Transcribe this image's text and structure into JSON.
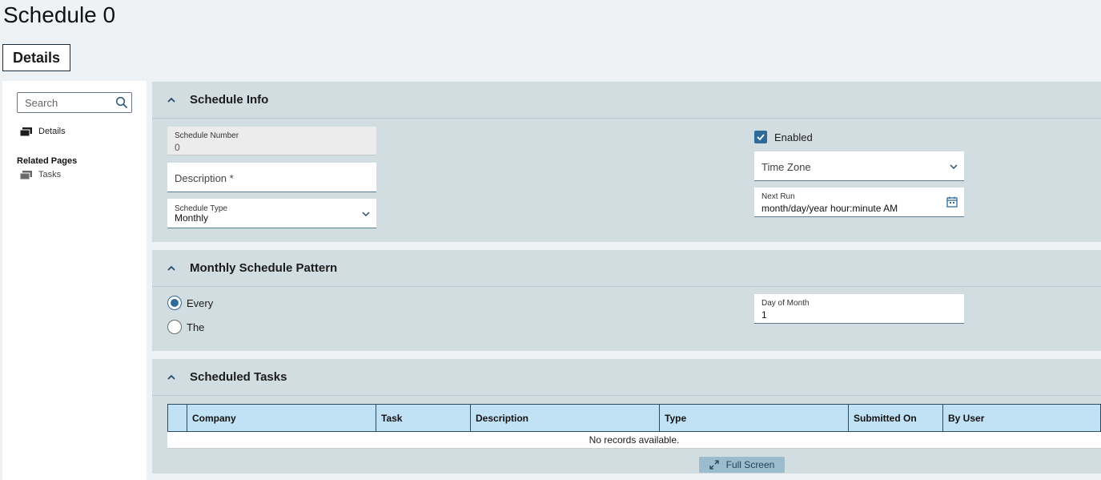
{
  "page": {
    "title": "Schedule 0"
  },
  "tabs": {
    "details": "Details"
  },
  "nav": {
    "search_placeholder": "Search",
    "details": "Details",
    "related_heading": "Related Pages",
    "tasks": "Tasks"
  },
  "schedule_info": {
    "title": "Schedule Info",
    "schedule_number_label": "Schedule Number",
    "schedule_number_value": "0",
    "description_label": "Description *",
    "schedule_type_label": "Schedule Type",
    "schedule_type_value": "Monthly",
    "enabled_label": "Enabled",
    "enabled_checked": true,
    "time_zone_label": "Time Zone",
    "next_run_label": "Next Run",
    "next_run_value": "month/day/year hour:minute AM"
  },
  "monthly_pattern": {
    "title": "Monthly Schedule Pattern",
    "option_every": "Every",
    "option_the": "The",
    "selected": "Every",
    "day_of_month_label": "Day of Month",
    "day_of_month_value": "1"
  },
  "scheduled_tasks": {
    "title": "Scheduled Tasks",
    "columns": [
      "Company",
      "Task",
      "Description",
      "Type",
      "Submitted On",
      "By User"
    ],
    "empty_text": "No records available.",
    "full_screen_label": "Full Screen"
  },
  "colors": {
    "accent": "#2f6b99",
    "section_bg": "#d2dde1",
    "grid_header_bg": "#c1e1f4"
  }
}
